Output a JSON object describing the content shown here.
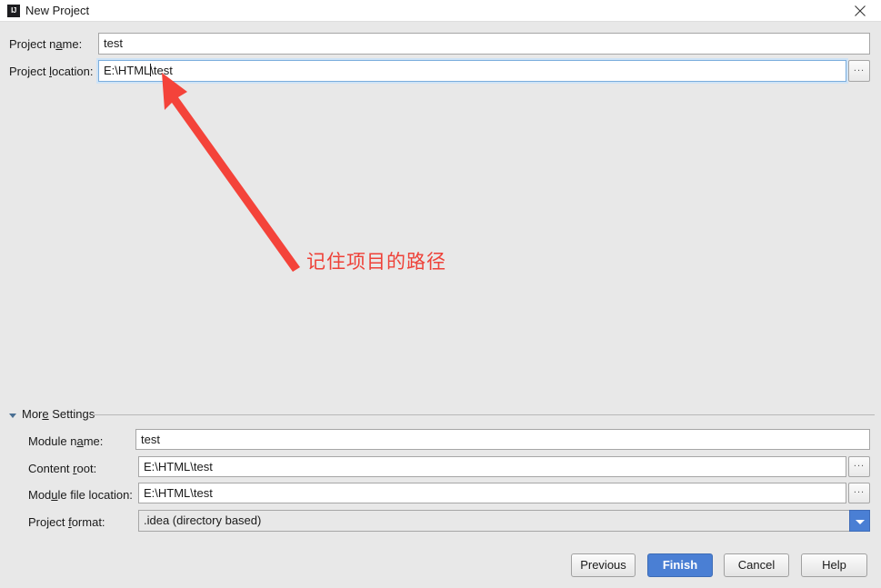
{
  "window": {
    "title": "New Project",
    "app_icon": "intellij-idea-icon",
    "icon_text": "IJ",
    "close_icon": "close-icon"
  },
  "colors": {
    "dialog_background": "#e8e8e8",
    "titlebar_background": "#ffffff",
    "field_background": "#ffffff",
    "focus_border": "#7aaddd",
    "accent_blue": "#4a7fd4",
    "annotation_red": "#ee4138",
    "text": "#1a1a1a"
  },
  "main_form": {
    "project_name": {
      "label_prefix": "Project n",
      "label_mnemonic": "a",
      "label_suffix": "me:",
      "value": "test",
      "placeholder": ""
    },
    "project_location": {
      "label_prefix": "Project ",
      "label_mnemonic": "l",
      "label_suffix": "ocation:",
      "value_before_caret": "E:\\HTML",
      "value_after_caret": "\\test",
      "value": "E:\\HTML\\test",
      "placeholder": "",
      "focused": true,
      "browse_label": "..."
    }
  },
  "more_settings": {
    "label_prefix": "Mor",
    "label_mnemonic": "e",
    "label_suffix": " Settings",
    "expanded": true,
    "collapse_icon": "chevron-down-icon",
    "rows": [
      {
        "name": "module-name",
        "label_prefix": "Module n",
        "label_mnemonic": "a",
        "label_suffix": "me:",
        "value": "test",
        "has_browse": false
      },
      {
        "name": "content-root",
        "label_prefix": "Content ",
        "label_mnemonic": "r",
        "label_suffix": "oot:",
        "value": "E:\\HTML\\test",
        "has_browse": true,
        "browse_label": "..."
      },
      {
        "name": "module-file-location",
        "label_prefix": "Mod",
        "label_mnemonic": "u",
        "label_suffix": "le file location:",
        "value": "E:\\HTML\\test",
        "has_browse": true,
        "browse_label": "..."
      }
    ],
    "project_format": {
      "label_prefix": "Project ",
      "label_mnemonic": "f",
      "label_suffix": "ormat:",
      "selected": ".idea (directory based)",
      "dropdown_icon": "chevron-down-icon"
    }
  },
  "buttons": {
    "previous": "Previous",
    "finish": "Finish",
    "cancel": "Cancel",
    "help": "Help"
  },
  "annotation": {
    "note": "记住项目的路径",
    "arrow": "red-arrow-pointing-to-project-location"
  }
}
